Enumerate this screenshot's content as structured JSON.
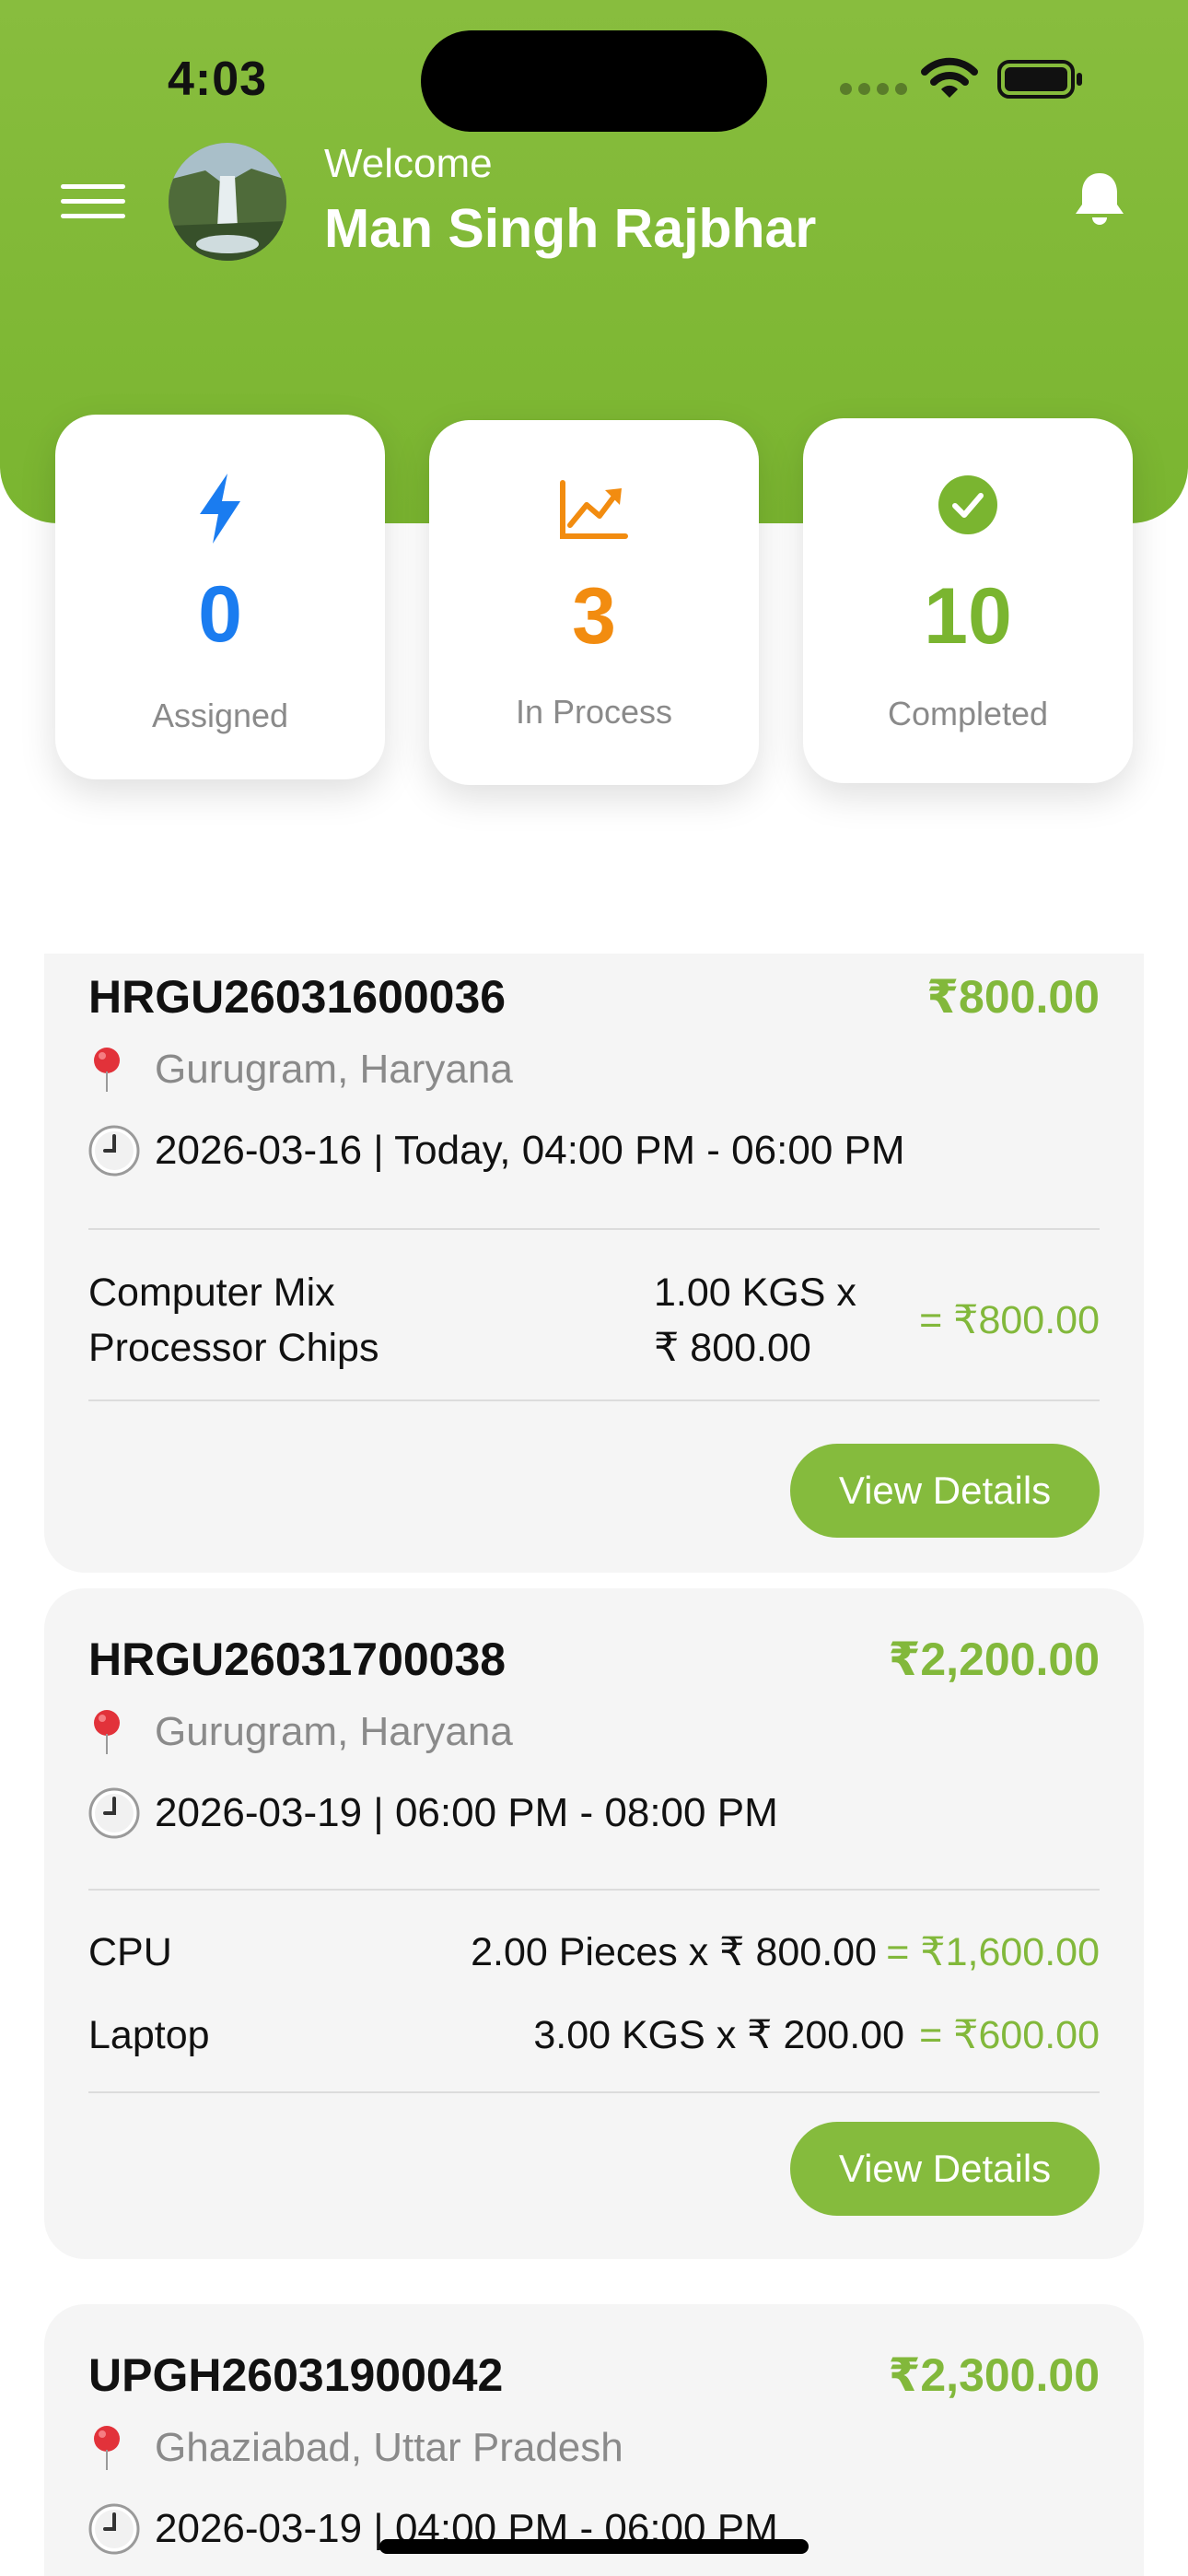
{
  "status_bar": {
    "time": "4:03"
  },
  "header": {
    "welcome": "Welcome",
    "user_name": "Man Singh Rajbhar",
    "accent": "#7ab530"
  },
  "stats": [
    {
      "icon": "lightning-bolt-icon",
      "value": "0",
      "label": "Assigned",
      "color": "#1a7cf0"
    },
    {
      "icon": "chart-trend-up-icon",
      "value": "3",
      "label": "In Process",
      "color": "#f28c10"
    },
    {
      "icon": "check-circle-icon",
      "value": "10",
      "label": "Completed",
      "color": "#7ab530"
    }
  ],
  "orders": [
    {
      "id": "HRGU26031600036",
      "total": "₹800.00",
      "location": "Gurugram, Haryana",
      "schedule": "2026-03-16 | Today, 04:00 PM - 06:00 PM",
      "items": [
        {
          "name_line1": "Computer Mix",
          "name_line2": "Processor Chips",
          "qty_line1": "1.00 KGS x",
          "qty_line2": "₹ 800.00",
          "total": "= ₹800.00"
        }
      ],
      "button": "View Details"
    },
    {
      "id": "HRGU26031700038",
      "total": "₹2,200.00",
      "location": "Gurugram, Haryana",
      "schedule": "2026-03-19 | 06:00 PM - 08:00 PM",
      "items": [
        {
          "name": "CPU",
          "qty": "2.00 Pieces x ₹ 800.00",
          "total": "= ₹1,600.00"
        },
        {
          "name": "Laptop",
          "qty": "3.00 KGS x ₹ 200.00",
          "total": "= ₹600.00"
        }
      ],
      "button": "View Details"
    },
    {
      "id": "UPGH26031900042",
      "total": "₹2,300.00",
      "location": "Ghaziabad, Uttar Pradesh",
      "schedule": "2026-03-19 | 04:00 PM - 06:00 PM"
    }
  ]
}
